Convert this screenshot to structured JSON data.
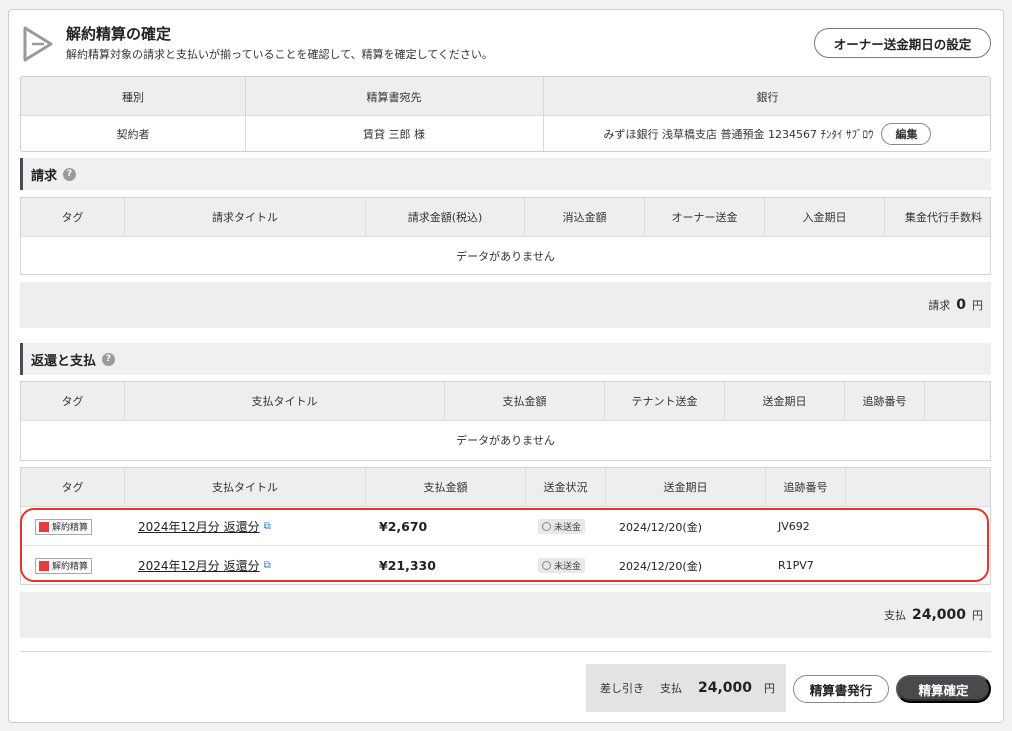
{
  "header": {
    "title": "解約精算の確定",
    "subtitle": "解約精算対象の請求と支払いが揃っていることを確認して、精算を確定してください。",
    "owner_button": "オーナー送金期日の設定"
  },
  "info": {
    "headers": [
      "種別",
      "精算書宛先",
      "銀行"
    ],
    "type": "契約者",
    "recipient": "賃貸 三郎 様",
    "bank": "みずほ銀行 浅草橋支店 普通預金 1234567 ﾁﾝﾀｲ ｻﾌﾞﾛｳ",
    "edit_button": "編集"
  },
  "billing": {
    "section_title": "請求",
    "columns": [
      "タグ",
      "請求タイトル",
      "請求金額(税込)",
      "消込金額",
      "オーナー送金",
      "入金期日",
      "集金代行手数料"
    ],
    "empty_text": "データがありません",
    "total_label": "請求",
    "total_value": "0",
    "total_unit": "円"
  },
  "refund": {
    "section_title": "返還と支払",
    "columns": [
      "タグ",
      "支払タイトル",
      "支払金額",
      "テナント送金",
      "送金期日",
      "追跡番号"
    ],
    "empty_text": "データがありません"
  },
  "payments": {
    "columns": [
      "タグ",
      "支払タイトル",
      "支払金額",
      "送金状況",
      "送金期日",
      "追跡番号"
    ],
    "rows": [
      {
        "tag": "解約精算",
        "title": "2024年12月分 返還分",
        "amount": "¥2,670",
        "status": "未送金",
        "date": "2024/12/20(金)",
        "tracking": "JV692"
      },
      {
        "tag": "解約精算",
        "title": "2024年12月分 返還分",
        "amount": "¥21,330",
        "status": "未送金",
        "date": "2024/12/20(金)",
        "tracking": "R1PV7"
      }
    ],
    "total_label": "支払",
    "total_value": "24,000",
    "total_unit": "円"
  },
  "footer": {
    "diff_label": "差し引き",
    "diff_type": "支払",
    "diff_value": "24,000",
    "diff_unit": "円",
    "issue_button": "精算書発行",
    "confirm_button": "精算確定"
  },
  "colors": {
    "tag_square": "#e53b3b",
    "highlight": "#e4352b",
    "confirm_button": "#4a4a4e",
    "link_icon": "#2a7fd8"
  }
}
